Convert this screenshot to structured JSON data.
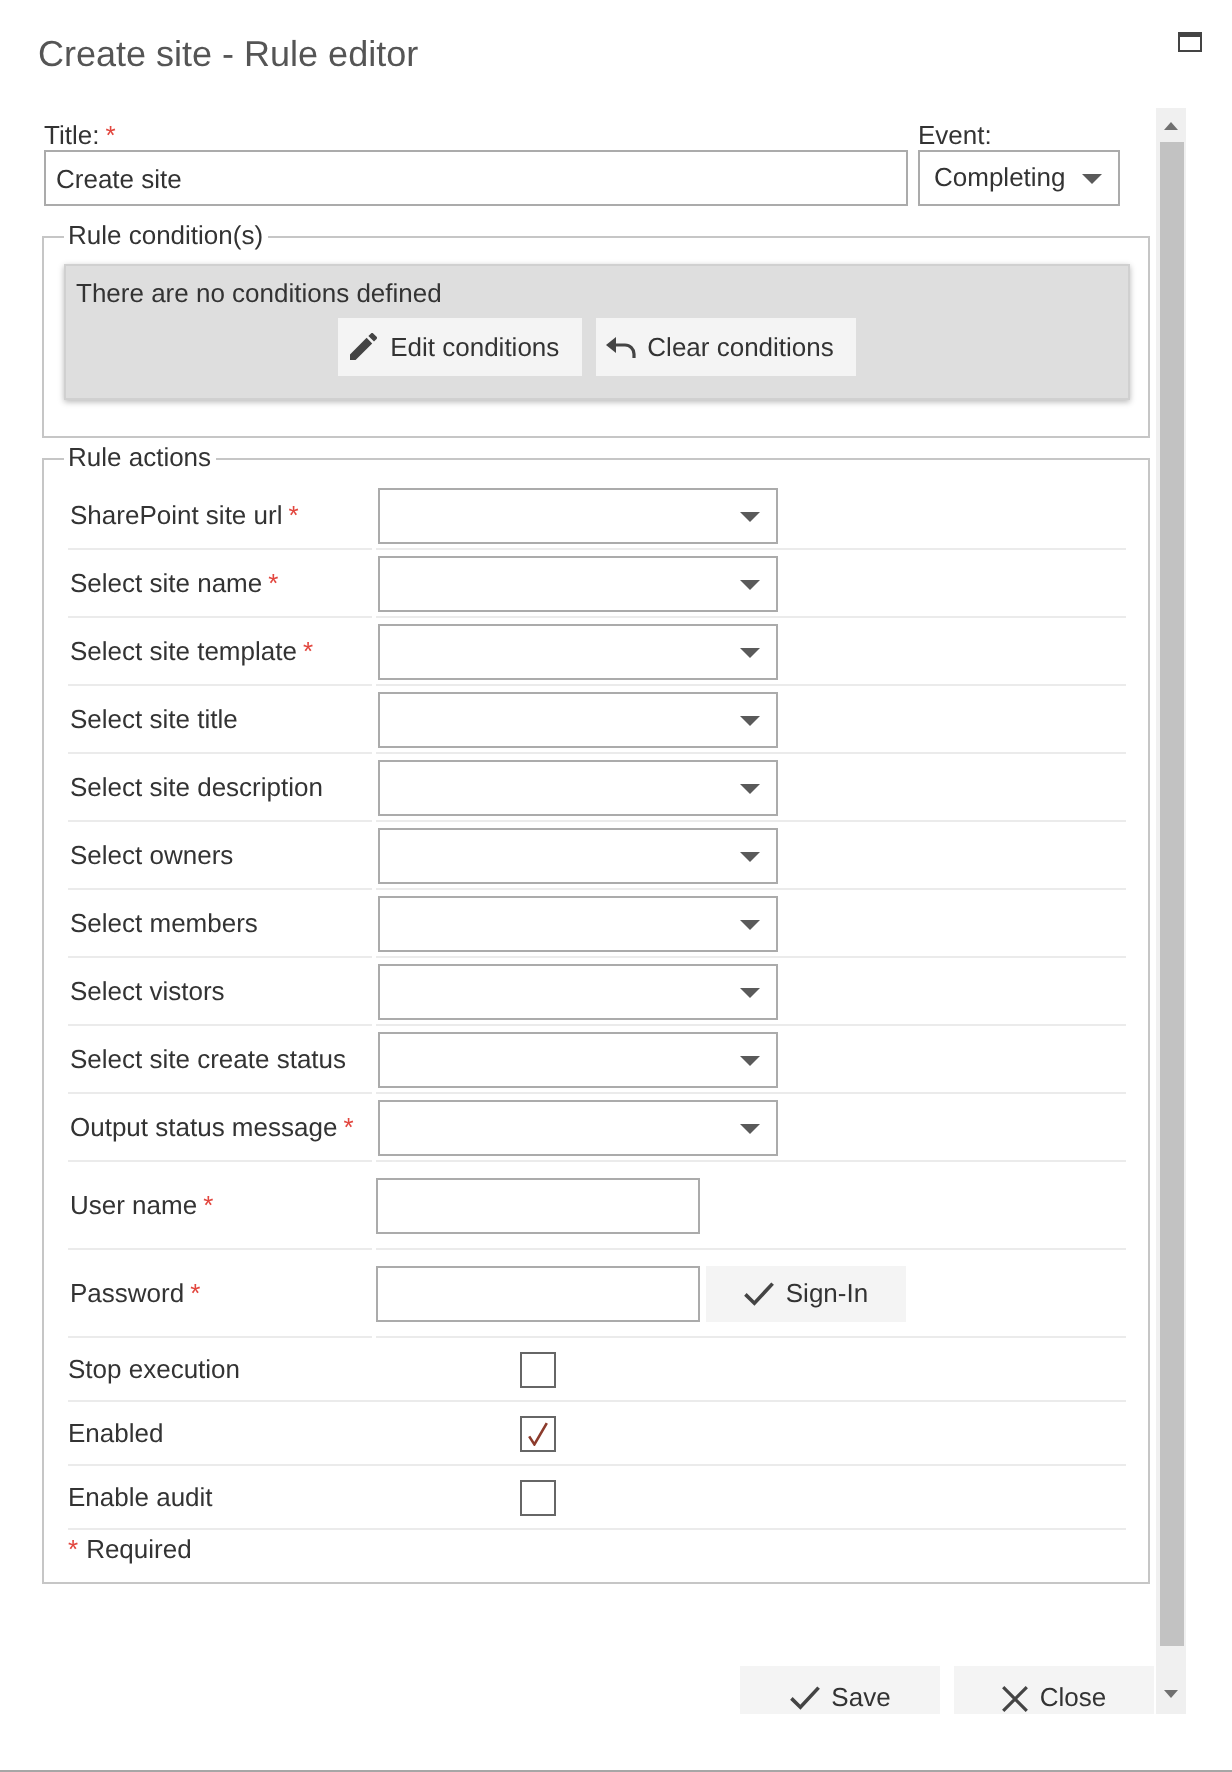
{
  "window": {
    "title": "Create site - Rule editor"
  },
  "header_fields": {
    "title": {
      "label": "Title:",
      "required_mark": "*",
      "value": "Create site"
    },
    "event": {
      "label": "Event:",
      "value": "Completing"
    }
  },
  "conditions": {
    "legend": "Rule condition(s)",
    "message": "There are no conditions defined",
    "buttons": [
      {
        "kind": "edit",
        "label": "Edit conditions"
      },
      {
        "kind": "clear",
        "label": "Clear conditions"
      }
    ]
  },
  "actions": {
    "legend": "Rule actions",
    "rows": [
      {
        "kind": "dropdown",
        "label": "SharePoint site url",
        "required_mark": "*"
      },
      {
        "kind": "dropdown",
        "label": "Select site name",
        "required_mark": "*"
      },
      {
        "kind": "dropdown",
        "label": "Select site template",
        "required_mark": "*"
      },
      {
        "kind": "dropdown",
        "label": "Select site title"
      },
      {
        "kind": "dropdown",
        "label": "Select site description"
      },
      {
        "kind": "dropdown",
        "label": "Select owners"
      },
      {
        "kind": "dropdown",
        "label": "Select members"
      },
      {
        "kind": "dropdown",
        "label": "Select vistors"
      },
      {
        "kind": "dropdown",
        "label": "Select site create status"
      },
      {
        "kind": "dropdown",
        "label": "Output status message",
        "required_mark": "*"
      },
      {
        "kind": "text",
        "label": "User name",
        "required_mark": "*"
      },
      {
        "kind": "password",
        "label": "Password",
        "required_mark": "*",
        "button": {
          "kind": "signin",
          "label": "Sign-In"
        }
      },
      {
        "kind": "checkbox",
        "label": "Stop execution",
        "checked": false
      },
      {
        "kind": "checkbox",
        "label": "Enabled",
        "checked": true
      },
      {
        "kind": "checkbox",
        "label": "Enable audit",
        "checked": false
      }
    ],
    "note": {
      "mark": "*",
      "text": "Required"
    }
  },
  "footer": {
    "buttons": [
      {
        "kind": "save",
        "label": "Save"
      },
      {
        "kind": "close",
        "label": "Close"
      }
    ]
  }
}
